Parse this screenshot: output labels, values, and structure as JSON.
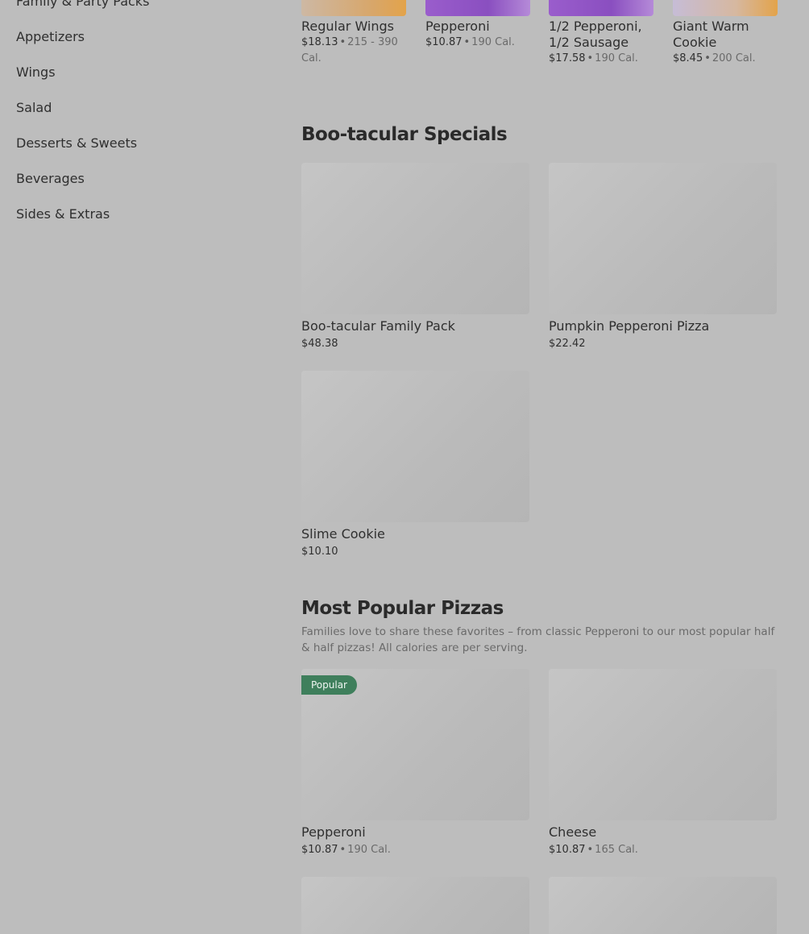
{
  "sidebar": {
    "items": [
      {
        "label": "Family & Party Packs"
      },
      {
        "label": "Appetizers"
      },
      {
        "label": "Wings"
      },
      {
        "label": "Salad"
      },
      {
        "label": "Desserts & Sweets"
      },
      {
        "label": "Beverages"
      },
      {
        "label": "Sides & Extras"
      }
    ]
  },
  "top_row": [
    {
      "name": "Regular Wings",
      "price": "$18.13",
      "cal": "215 - 390 Cal."
    },
    {
      "name": "Pepperoni",
      "price": "$10.87",
      "cal": "190 Cal."
    },
    {
      "name": "1/2 Pepperoni, 1/2 Sausage",
      "price": "$17.58",
      "cal": "190 Cal."
    },
    {
      "name": "Giant Warm Cookie",
      "price": "$8.45",
      "cal": "200 Cal."
    }
  ],
  "specials": {
    "title": "Boo-tacular Specials",
    "items": [
      {
        "name": "Boo-tacular Family Pack",
        "price": "$48.38"
      },
      {
        "name": "Pumpkin Pepperoni Pizza",
        "price": "$22.42"
      },
      {
        "name": "Slime Cookie",
        "price": "$10.10"
      }
    ]
  },
  "popular": {
    "title": "Most Popular Pizzas",
    "description": "Families love to share these favorites – from classic Pepperoni to our most popular half & half pizzas! All calories are per serving.",
    "badge": "Popular",
    "items": [
      {
        "name": "Pepperoni",
        "price": "$10.87",
        "cal": "190 Cal."
      },
      {
        "name": "Cheese",
        "price": "$10.87",
        "cal": "165 Cal."
      }
    ]
  },
  "separator": "•",
  "colors": {
    "background": "#bdbdbd",
    "badge": "#3f7f5c",
    "thumb_orange": "#e3a34a",
    "thumb_purple": "#8a4fc0"
  }
}
